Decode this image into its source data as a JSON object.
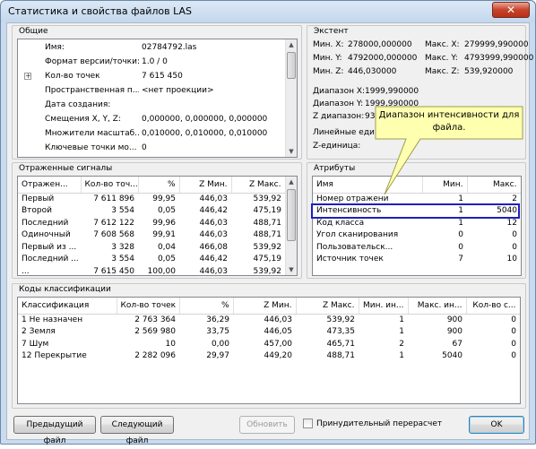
{
  "window": {
    "title": "Статистика и свойства файлов LAS",
    "close_glyph": "✕"
  },
  "general": {
    "title": "Общие",
    "rows": [
      {
        "mark": "",
        "name": "Имя:",
        "value": "02784792.las"
      },
      {
        "mark": "",
        "name": "Формат версии/точки:",
        "value": "1.0 / 0"
      },
      {
        "mark": "+",
        "name": "Кол-во точек",
        "value": "7 615 450"
      },
      {
        "mark": "",
        "name": "Пространственная п...",
        "value": "<нет проекции>"
      },
      {
        "mark": "",
        "name": "Дата создания:",
        "value": ""
      },
      {
        "mark": "",
        "name": "Смещения X, Y, Z:",
        "value": "0,000000, 0,000000, 0,000000"
      },
      {
        "mark": "",
        "name": "Множители масштаб...",
        "value": "0,010000, 0,010000, 0,010000"
      },
      {
        "mark": "",
        "name": "Ключевые точки мо...",
        "value": "0"
      }
    ]
  },
  "extent": {
    "title": "Экстент",
    "min_x_label": "Мин. X:",
    "min_x": "278000,000000",
    "max_x_label": "Макс. X:",
    "max_x": "279999,990000",
    "min_y_label": "Мин. Y:",
    "min_y": "4792000,000000",
    "max_y_label": "Макс. Y:",
    "max_y": "4793999,990000",
    "min_z_label": "Мин. Z:",
    "min_z": "446,030000",
    "max_z_label": "Макс. Z:",
    "max_z": "539,920000",
    "range_x_label": "Диапазон X:",
    "range_x": "1999,990000",
    "range_y_label": "Диапазон Y:",
    "range_y": "1999,990000",
    "range_z_label": "Z диапазон:",
    "range_z": "93,",
    "linear_units_label": "Линейные едини",
    "z_units_label": "Z-единица:"
  },
  "returns": {
    "title": "Отраженные сигналы",
    "columns": [
      "Отражен...",
      "Кол-во точ...",
      "%",
      "Z Мин.",
      "Z Макс."
    ],
    "rows": [
      [
        "Первый",
        "7 611 896",
        "99,95",
        "446,03",
        "539,92"
      ],
      [
        "Второй",
        "3 554",
        "0,05",
        "446,42",
        "475,19"
      ],
      [
        "Последний",
        "7 612 122",
        "99,96",
        "446,03",
        "488,71"
      ],
      [
        "Одиночный",
        "7 608 568",
        "99,91",
        "446,03",
        "488,71"
      ],
      [
        "Первый из ...",
        "3 328",
        "0,04",
        "466,08",
        "539,92"
      ],
      [
        "Последний ...",
        "3 554",
        "0,05",
        "446,42",
        "475,19"
      ],
      [
        "...",
        "7 615 450",
        "100,00",
        "446,03",
        "539,92"
      ]
    ]
  },
  "attributes": {
    "title": "Атрибуты",
    "columns": [
      "Имя",
      "Мин.",
      "Макс."
    ],
    "rows": [
      [
        "Номер отражени",
        "1",
        "2"
      ],
      [
        "Интенсивность",
        "1",
        "5040"
      ],
      [
        "Код класса",
        "1",
        "12"
      ],
      [
        "Угол сканирования",
        "0",
        "0"
      ],
      [
        "Пользовательск...",
        "0",
        "0"
      ],
      [
        "Источник точек",
        "7",
        "10"
      ]
    ]
  },
  "callout": {
    "text": "Диапазон интенсивности для файла.",
    "fill": "#ffffb0",
    "border": "#9c9c4a"
  },
  "classification": {
    "title": "Коды классификации",
    "columns": [
      "Классификация",
      "Кол-во точек",
      "%",
      "Z Мин.",
      "Z Макс.",
      "Мин. ин...",
      "Макс. ин...",
      "Кол-во с..."
    ],
    "rows": [
      [
        "1 Не назначен",
        "2 763 364",
        "36,29",
        "446,03",
        "539,92",
        "1",
        "900",
        "0"
      ],
      [
        "2 Земля",
        "2 569 980",
        "33,75",
        "446,05",
        "473,35",
        "1",
        "900",
        "0"
      ],
      [
        "7 Шум",
        "10",
        "0,00",
        "457,00",
        "465,71",
        "2",
        "67",
        "0"
      ],
      [
        "12 Перекрытие",
        "2 282 096",
        "29,97",
        "449,20",
        "488,71",
        "1",
        "5040",
        "0"
      ]
    ]
  },
  "footer": {
    "prev": "Предыдущий файл",
    "next": "Следующий файл",
    "refresh": "Обновить",
    "force_label": "Принудительный перерасчет",
    "force_checked": false,
    "ok": "OK"
  },
  "colors": {
    "highlight_border": "#1f1fbf",
    "close_red": "#c7432b"
  }
}
